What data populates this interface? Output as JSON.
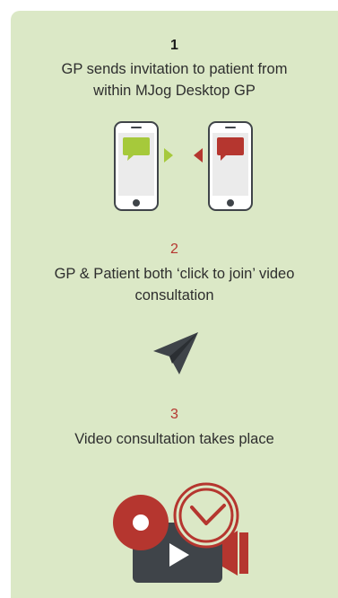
{
  "steps": [
    {
      "number": "1",
      "line1": "GP sends invitation to patient from",
      "line2": "within MJog Desktop GP",
      "icon": "phones-messaging-icon"
    },
    {
      "number": "2",
      "line1": "GP & Patient both ‘click to join’ video",
      "line2": "consultation",
      "icon": "paper-plane-icon"
    },
    {
      "number": "3",
      "line1": "Video consultation takes place",
      "icon": "video-camera-clock-icon"
    }
  ],
  "colors": {
    "panel_background": "#dbe8c6",
    "accent_red": "#b5362f",
    "accent_green": "#a6c93b",
    "dark_gray": "#3f4449"
  }
}
